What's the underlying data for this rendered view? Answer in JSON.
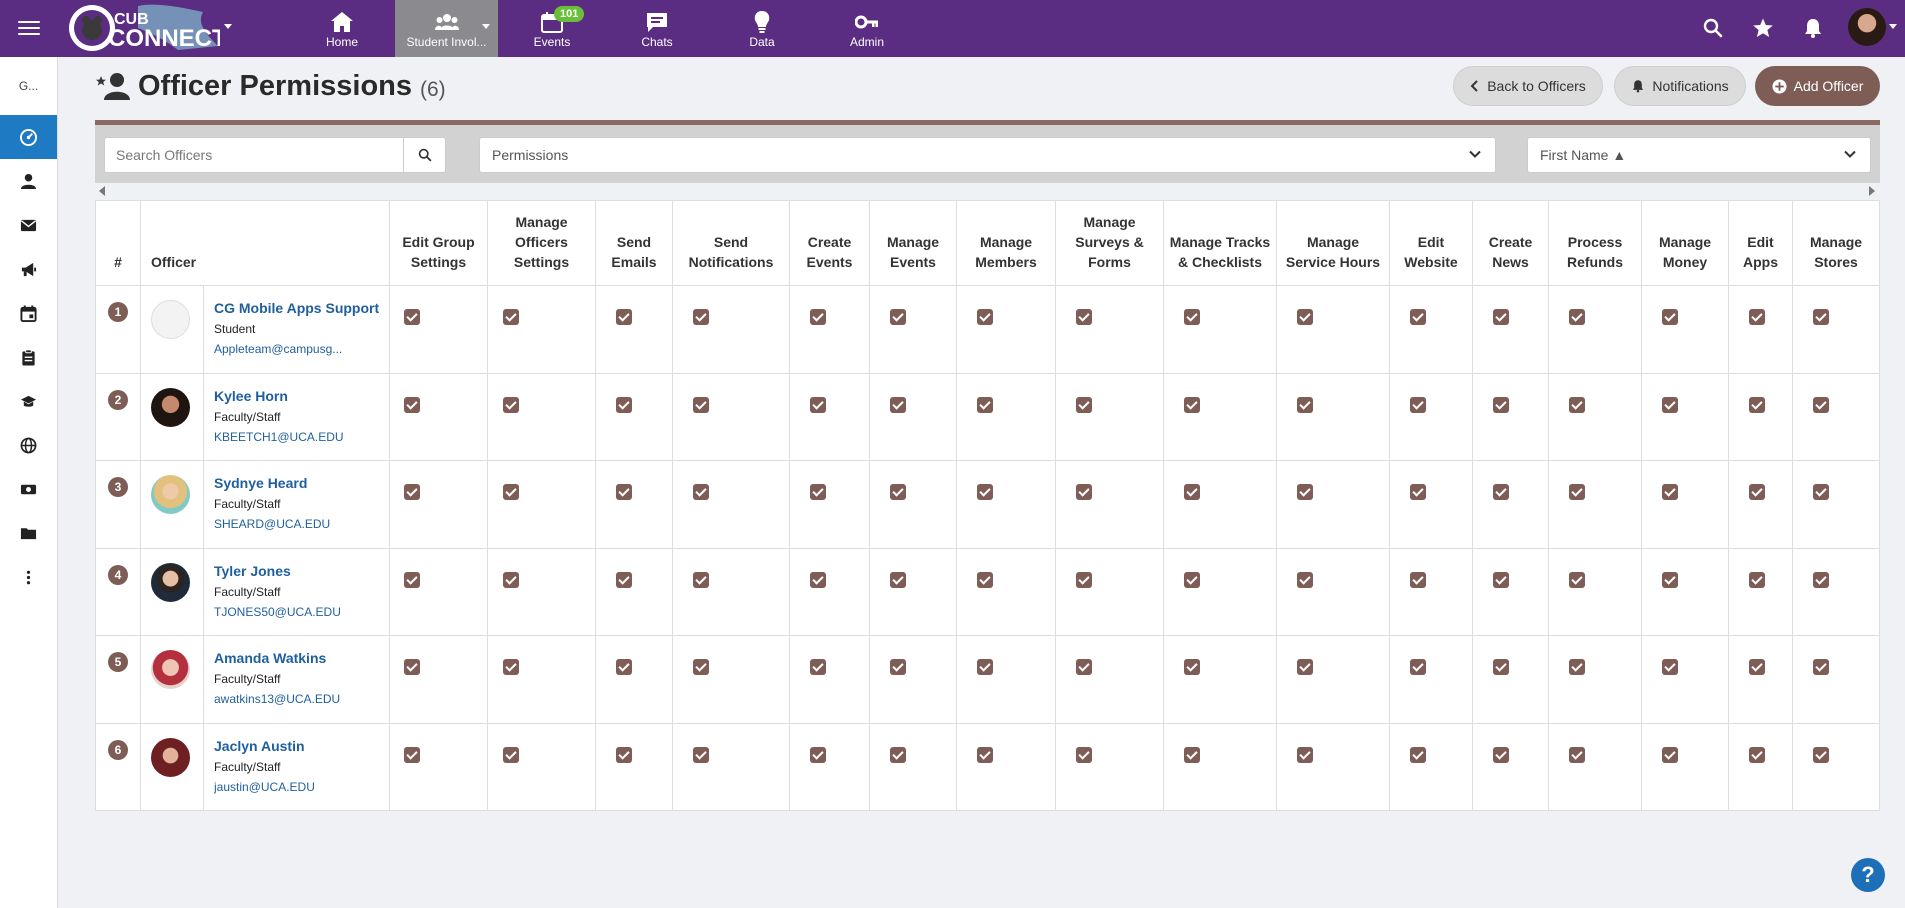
{
  "topbar": {
    "logo_text": "CUB CONNECT",
    "nav": [
      {
        "label": "Home",
        "icon": "home-icon"
      },
      {
        "label": "Student Invol...",
        "icon": "group-icon",
        "active": true
      },
      {
        "label": "Events",
        "icon": "calendar-icon",
        "badge": "101"
      },
      {
        "label": "Chats",
        "icon": "chat-icon"
      },
      {
        "label": "Data",
        "icon": "lightbulb-icon"
      },
      {
        "label": "Admin",
        "icon": "key-icon"
      }
    ]
  },
  "sidebar": {
    "top_label": "G...",
    "items": [
      "dashboard-icon",
      "person-icon",
      "envelope-icon",
      "megaphone-icon",
      "calendar-icon",
      "clipboard-icon",
      "graduation-cap-icon",
      "globe-icon",
      "money-icon",
      "folder-icon",
      "more-vertical-icon"
    ]
  },
  "header": {
    "title": "Officer Permissions",
    "count": "(6)",
    "back_label": "Back to Officers",
    "notifications_label": "Notifications",
    "add_label": "Add Officer"
  },
  "filters": {
    "search_placeholder": "Search Officers",
    "permissions_label": "Permissions",
    "sort_label": "First Name ▲"
  },
  "table": {
    "num_header": "#",
    "officer_header": "Officer",
    "permissions": [
      "Edit Group Settings",
      "Manage Officers Settings",
      "Send Emails",
      "Send Notifications",
      "Create Events",
      "Manage Events",
      "Manage Members",
      "Manage Surveys & Forms",
      "Manage Tracks & Checklists",
      "Manage Service Hours",
      "Edit Website",
      "Create News",
      "Process Refunds",
      "Manage Money",
      "Edit Apps",
      "Manage Stores"
    ],
    "rows": [
      {
        "num": "1",
        "name": "CG Mobile Apps Support",
        "role": "Student",
        "email": "Appleteam@campusg..."
      },
      {
        "num": "2",
        "name": "Kylee Horn",
        "role": "Faculty/Staff",
        "email": "KBEETCH1@UCA.EDU"
      },
      {
        "num": "3",
        "name": "Sydnye Heard",
        "role": "Faculty/Staff",
        "email": "SHEARD@UCA.EDU"
      },
      {
        "num": "4",
        "name": "Tyler Jones",
        "role": "Faculty/Staff",
        "email": "TJONES50@UCA.EDU"
      },
      {
        "num": "5",
        "name": "Amanda Watkins",
        "role": "Faculty/Staff",
        "email": "awatkins13@UCA.EDU"
      },
      {
        "num": "6",
        "name": "Jaclyn Austin",
        "role": "Faculty/Staff",
        "email": "jaustin@UCA.EDU"
      }
    ]
  },
  "colors": {
    "brand_purple": "#5b2d82",
    "accent_brown": "#7f5d57",
    "link_blue": "#1f5f9e",
    "sidebar_active": "#1d7ac3"
  },
  "help_label": "?"
}
